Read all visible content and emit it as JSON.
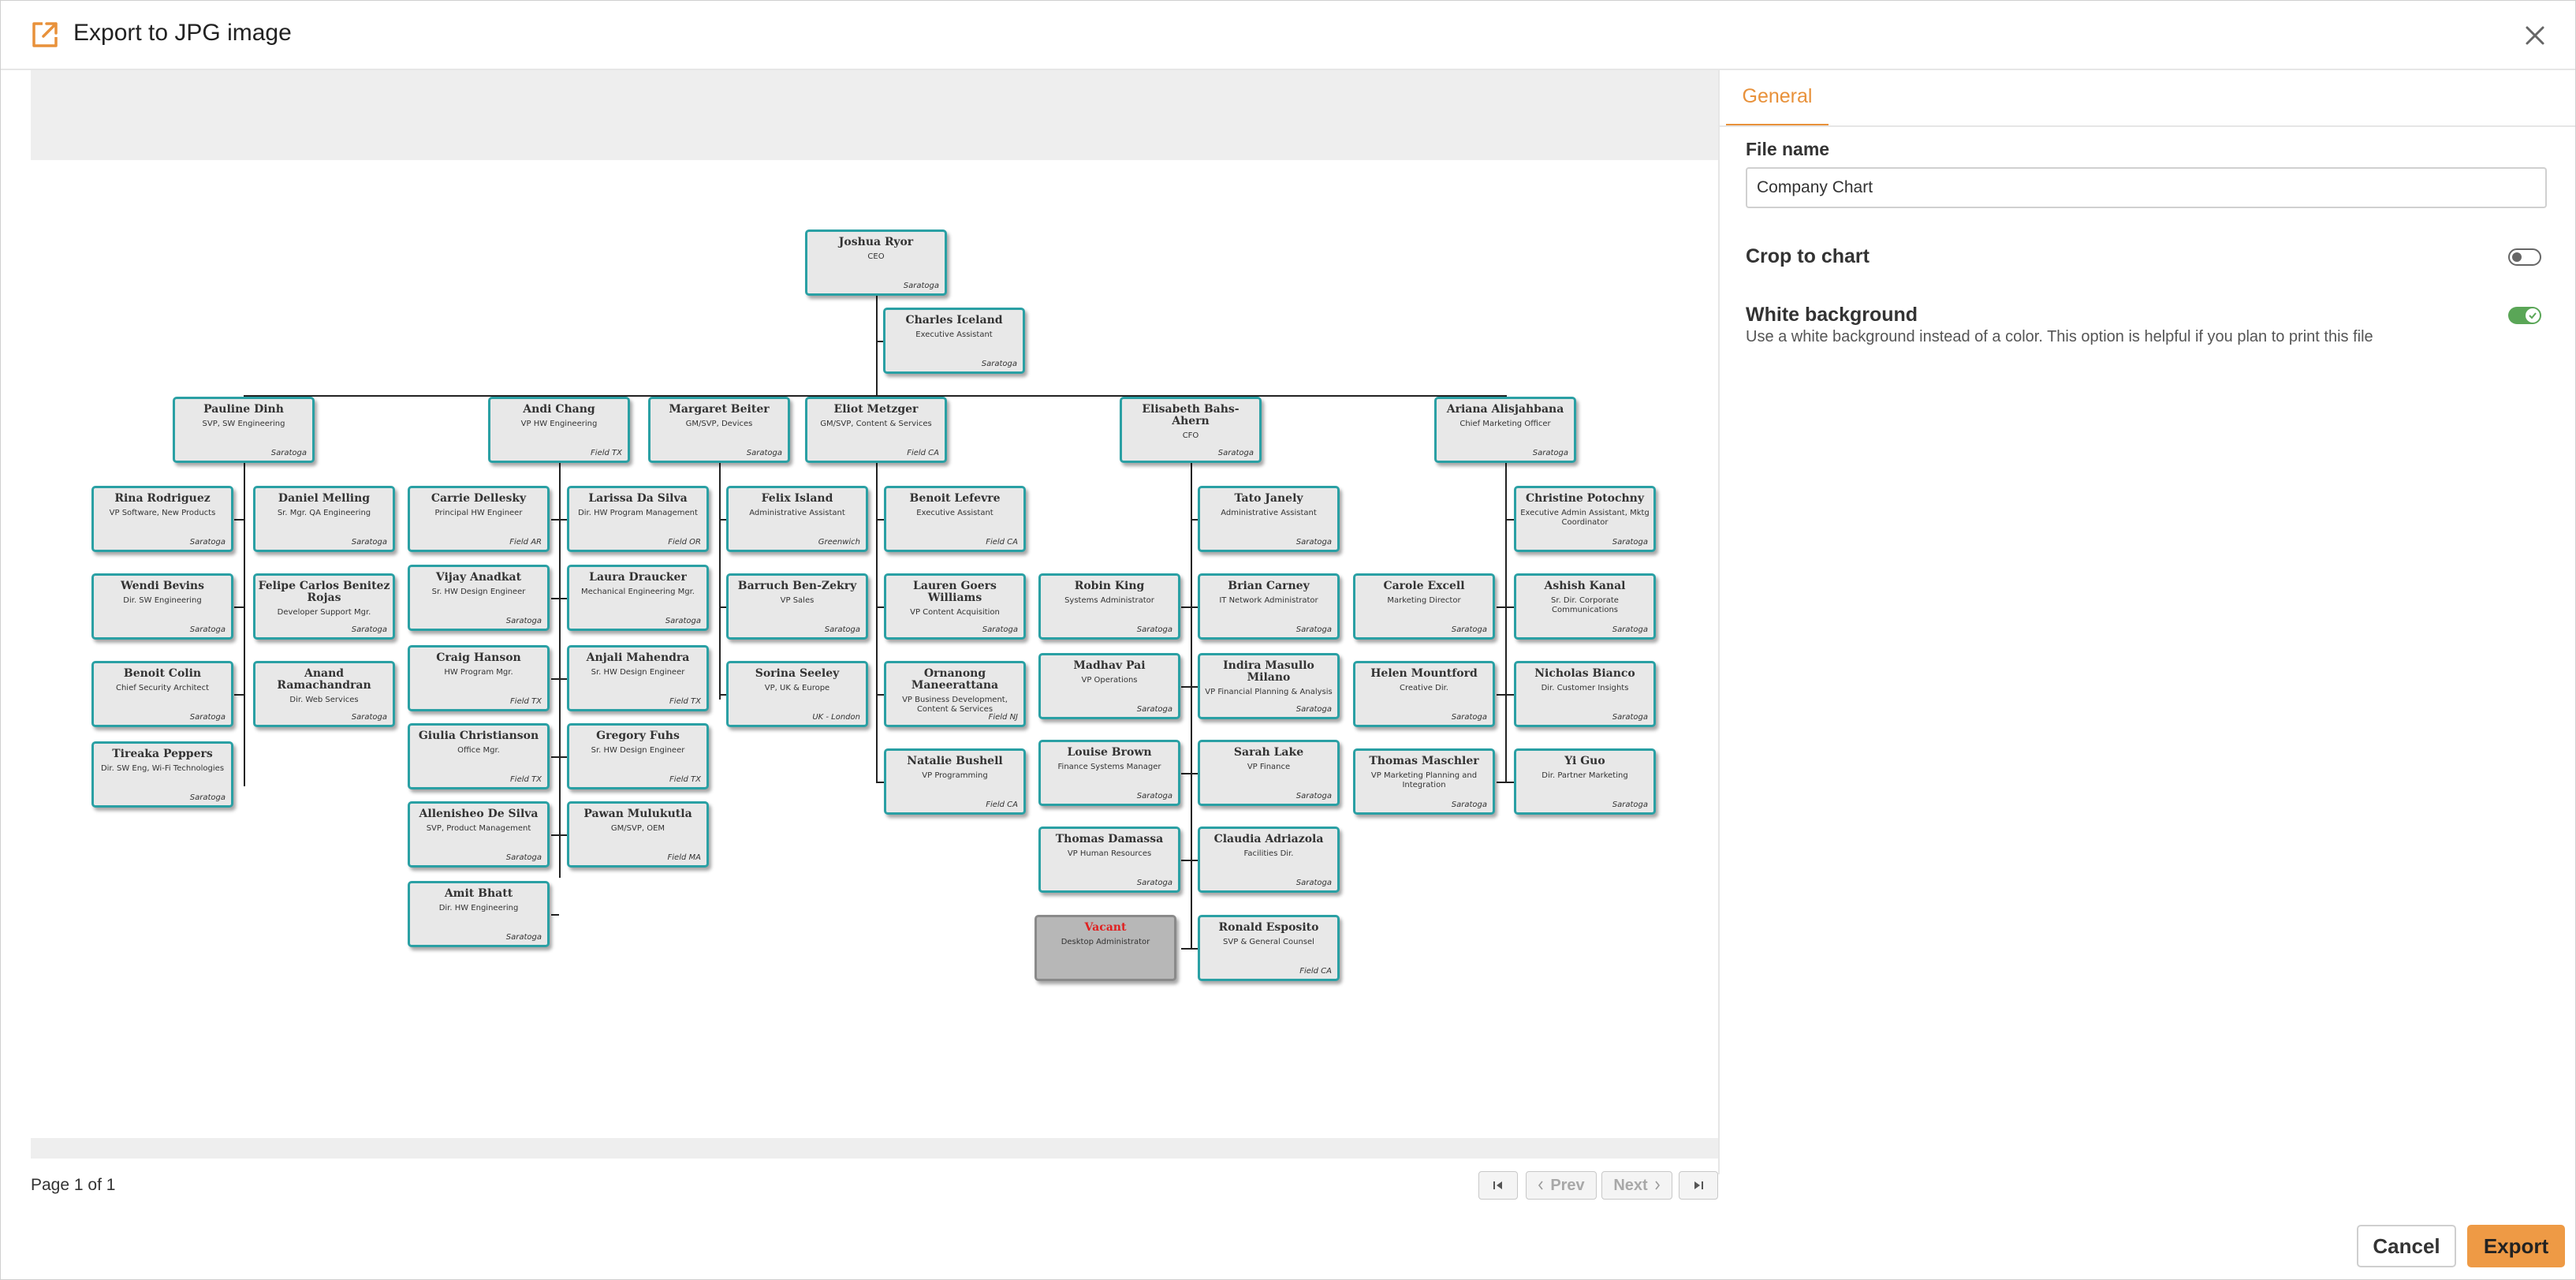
{
  "dialog": {
    "title": "Export to JPG image",
    "title_icon": "external-link-icon",
    "close_icon": "close-icon"
  },
  "pager": {
    "page_text": "Page 1 of 1",
    "first_icon": "first-page-icon",
    "prev_label": "Prev",
    "next_label": "Next",
    "last_icon": "last-page-icon"
  },
  "settings": {
    "tab_general": "General",
    "file_name_label": "File name",
    "file_name_value": "Company Chart",
    "crop_label": "Crop to chart",
    "crop_enabled": false,
    "white_bg_label": "White background",
    "white_bg_desc": "Use a white background instead of a color. This option is helpful if you plan to print this file",
    "white_bg_enabled": true
  },
  "buttons": {
    "cancel": "Cancel",
    "export": "Export"
  },
  "colors": {
    "accent": "#ee9a45",
    "tab_accent": "#e8913a",
    "node_border": "#2aa0a4",
    "toggle_on": "#5aa657",
    "vacant_text": "#e02020"
  },
  "org": {
    "nodes": [
      {
        "name": "Joshua Ryor",
        "title": "CEO",
        "loc": "Saratoga"
      },
      {
        "name": "Charles Iceland",
        "title": "Executive Assistant",
        "loc": "Saratoga"
      },
      {
        "name": "Pauline Dinh",
        "title": "SVP, SW Engineering",
        "loc": "Saratoga"
      },
      {
        "name": "Andi Chang",
        "title": "VP HW Engineering",
        "loc": "Field TX"
      },
      {
        "name": "Margaret Beiter",
        "title": "GM/SVP, Devices",
        "loc": "Saratoga"
      },
      {
        "name": "Eliot Metzger",
        "title": "GM/SVP, Content & Services",
        "loc": "Field CA"
      },
      {
        "name": "Elisabeth Bahs-Ahern",
        "title": "CFO",
        "loc": "Saratoga"
      },
      {
        "name": "Ariana Alisjahbana",
        "title": "Chief Marketing Officer",
        "loc": "Saratoga"
      },
      {
        "name": "Rina Rodriguez",
        "title": "VP Software, New Products",
        "loc": "Saratoga"
      },
      {
        "name": "Wendi Bevins",
        "title": "Dir. SW Engineering",
        "loc": "Saratoga"
      },
      {
        "name": "Benoit Colin",
        "title": "Chief Security Architect",
        "loc": "Saratoga"
      },
      {
        "name": "Tireaka Peppers",
        "title": "Dir. SW Eng, Wi-Fi Technologies",
        "loc": "Saratoga"
      },
      {
        "name": "Daniel Melling",
        "title": "Sr. Mgr. QA Engineering",
        "loc": "Saratoga"
      },
      {
        "name": "Felipe Carlos Benitez Rojas",
        "title": "Developer Support Mgr.",
        "loc": "Saratoga"
      },
      {
        "name": "Anand Ramachandran",
        "title": "Dir. Web Services",
        "loc": "Saratoga"
      },
      {
        "name": "Carrie Dellesky",
        "title": "Principal HW Engineer",
        "loc": "Field AR"
      },
      {
        "name": "Vijay Anadkat",
        "title": "Sr. HW Design Engineer",
        "loc": "Saratoga"
      },
      {
        "name": "Craig Hanson",
        "title": "HW Program Mgr.",
        "loc": "Field TX"
      },
      {
        "name": "Giulia Christianson",
        "title": "Office Mgr.",
        "loc": "Field TX"
      },
      {
        "name": "Allenisheo De Silva",
        "title": "SVP, Product Management",
        "loc": "Saratoga"
      },
      {
        "name": "Amit Bhatt",
        "title": "Dir. HW Engineering",
        "loc": "Saratoga"
      },
      {
        "name": "Larissa Da Silva",
        "title": "Dir. HW Program Management",
        "loc": "Field OR"
      },
      {
        "name": "Laura Draucker",
        "title": "Mechanical Engineering Mgr.",
        "loc": "Saratoga"
      },
      {
        "name": "Anjali Mahendra",
        "title": "Sr. HW Design Engineer",
        "loc": "Field TX"
      },
      {
        "name": "Gregory Fuhs",
        "title": "Sr. HW Design Engineer",
        "loc": "Field TX"
      },
      {
        "name": "Pawan Mulukutla",
        "title": "GM/SVP, OEM",
        "loc": "Field MA"
      },
      {
        "name": "Felix Island",
        "title": "Administrative Assistant",
        "loc": "Greenwich"
      },
      {
        "name": "Barruch Ben-Zekry",
        "title": "VP Sales",
        "loc": "Saratoga"
      },
      {
        "name": "Sorina Seeley",
        "title": "VP, UK & Europe",
        "loc": "UK - London"
      },
      {
        "name": "Benoit Lefevre",
        "title": "Executive Assistant",
        "loc": "Field CA"
      },
      {
        "name": "Lauren Goers Williams",
        "title": "VP Content Acquisition",
        "loc": "Saratoga"
      },
      {
        "name": "Ornanong Maneerattana",
        "title": "VP Business Development, Content & Services",
        "loc": "Field NJ"
      },
      {
        "name": "Natalie Bushell",
        "title": "VP Programming",
        "loc": "Field CA"
      },
      {
        "name": "Robin King",
        "title": "Systems Administrator",
        "loc": "Saratoga"
      },
      {
        "name": "Madhav Pai",
        "title": "VP Operations",
        "loc": "Saratoga"
      },
      {
        "name": "Louise Brown",
        "title": "Finance Systems Manager",
        "loc": "Saratoga"
      },
      {
        "name": "Thomas Damassa",
        "title": "VP Human Resources",
        "loc": "Saratoga"
      },
      {
        "name": "Vacant",
        "title": "Desktop Administrator",
        "loc": ""
      },
      {
        "name": "Tato Janely",
        "title": "Administrative Assistant",
        "loc": "Saratoga"
      },
      {
        "name": "Brian Carney",
        "title": "IT Network Administrator",
        "loc": "Saratoga"
      },
      {
        "name": "Indira Masullo Milano",
        "title": "VP Financial Planning & Analysis",
        "loc": "Saratoga"
      },
      {
        "name": "Sarah Lake",
        "title": "VP Finance",
        "loc": "Saratoga"
      },
      {
        "name": "Claudia Adriazola",
        "title": "Facilities Dir.",
        "loc": "Saratoga"
      },
      {
        "name": "Ronald Esposito",
        "title": "SVP & General Counsel",
        "loc": "Field CA"
      },
      {
        "name": "Carole Excell",
        "title": "Marketing Director",
        "loc": "Saratoga"
      },
      {
        "name": "Helen Mountford",
        "title": "Creative Dir.",
        "loc": "Saratoga"
      },
      {
        "name": "Thomas Maschler",
        "title": "VP Marketing Planning and Integration",
        "loc": "Saratoga"
      },
      {
        "name": "Christine Potochny",
        "title": "Executive Admin Assistant, Mktg Coordinator",
        "loc": "Saratoga"
      },
      {
        "name": "Ashish Kanal",
        "title": "Sr. Dir. Corporate Communications",
        "loc": "Saratoga"
      },
      {
        "name": "Nicholas Bianco",
        "title": "Dir. Customer Insights",
        "loc": "Saratoga"
      },
      {
        "name": "Yi Guo",
        "title": "Dir. Partner Marketing",
        "loc": "Saratoga"
      }
    ]
  }
}
